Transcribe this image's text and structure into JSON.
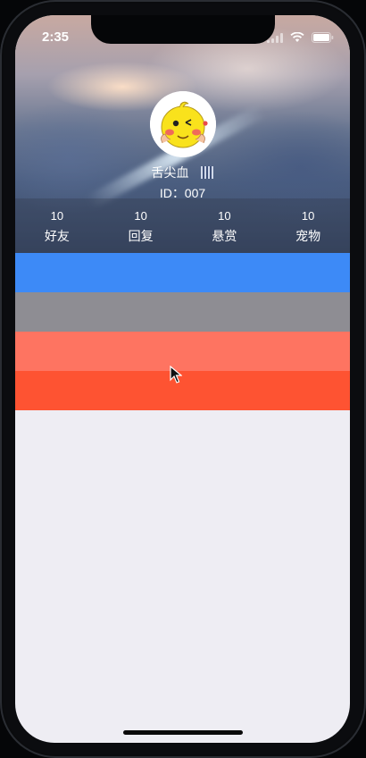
{
  "status_bar": {
    "time": "2:35"
  },
  "profile": {
    "name": "舌尖血",
    "id_text": "ID：007"
  },
  "stats": [
    {
      "value": "10",
      "label": "好友"
    },
    {
      "value": "10",
      "label": "回复"
    },
    {
      "value": "10",
      "label": "悬赏"
    },
    {
      "value": "10",
      "label": "宠物"
    }
  ],
  "colors": {
    "row1": "#3d8af7",
    "row2": "#8e8d93",
    "row3": "#fe7461",
    "row4": "#fe5332",
    "background": "#eeedf3"
  },
  "icons": [
    "avatar-emoji",
    "qr-code-icon",
    "cursor-icon",
    "signal-icon",
    "wifi-icon",
    "battery-icon"
  ]
}
